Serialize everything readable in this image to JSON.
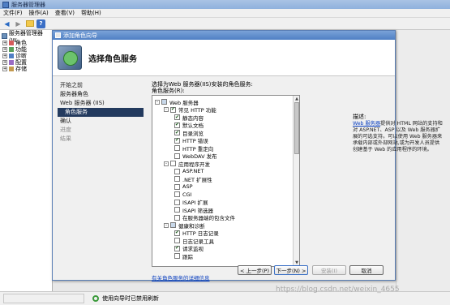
{
  "server_manager": {
    "title": "服务器管理器",
    "menu": [
      "文件(F)",
      "操作(A)",
      "查看(V)",
      "帮助(H)"
    ],
    "tree": {
      "root": "服务器管理器 (W",
      "items": [
        "角色",
        "功能",
        "诊断",
        "配置",
        "存储"
      ]
    },
    "status_text": "使用向导时已禁用刷新"
  },
  "wizard": {
    "title": "添加角色向导",
    "header_title": "选择角色服务",
    "nav": [
      {
        "label": "开始之前",
        "state": "normal"
      },
      {
        "label": "服务器角色",
        "state": "normal"
      },
      {
        "label": "Web 服务器 (IIS)",
        "state": "normal"
      },
      {
        "label": "角色服务",
        "state": "active"
      },
      {
        "label": "确认",
        "state": "normal"
      },
      {
        "label": "进度",
        "state": "disabled"
      },
      {
        "label": "结果",
        "state": "disabled"
      }
    ],
    "prompt": "选择为Web 服务器(IIS)安装的角色服务:",
    "services_label": "角色服务(R):",
    "services": [
      {
        "label": "Web 服务器",
        "level": 0,
        "check": "partial",
        "expander": "-"
      },
      {
        "label": "常见 HTTP 功能",
        "level": 1,
        "check": "checked",
        "expander": "-"
      },
      {
        "label": "静态内容",
        "level": 2,
        "check": "checked"
      },
      {
        "label": "默认文档",
        "level": 2,
        "check": "checked"
      },
      {
        "label": "目录浏览",
        "level": 2,
        "check": "checked"
      },
      {
        "label": "HTTP 错误",
        "level": 2,
        "check": "checked"
      },
      {
        "label": "HTTP 重定向",
        "level": 2,
        "check": "none"
      },
      {
        "label": "WebDAV 发布",
        "level": 2,
        "check": "none"
      },
      {
        "label": "应用程序开发",
        "level": 1,
        "check": "none",
        "expander": "-"
      },
      {
        "label": "ASP.NET",
        "level": 2,
        "check": "none"
      },
      {
        "label": ".NET 扩展性",
        "level": 2,
        "check": "none"
      },
      {
        "label": "ASP",
        "level": 2,
        "check": "none"
      },
      {
        "label": "CGI",
        "level": 2,
        "check": "none"
      },
      {
        "label": "ISAPI 扩展",
        "level": 2,
        "check": "none"
      },
      {
        "label": "ISAPI 筛选器",
        "level": 2,
        "check": "none"
      },
      {
        "label": "在服务器端的包含文件",
        "level": 2,
        "check": "none"
      },
      {
        "label": "健康和诊断",
        "level": 1,
        "check": "partial",
        "expander": "-"
      },
      {
        "label": "HTTP 日志记录",
        "level": 2,
        "check": "checked"
      },
      {
        "label": "日志记录工具",
        "level": 2,
        "check": "none"
      },
      {
        "label": "请求监视",
        "level": 2,
        "check": "checked"
      },
      {
        "label": "跟踪",
        "level": 2,
        "check": "none"
      }
    ],
    "description_title": "描述:",
    "description_link": "Web 服务器",
    "description_body": "提供对 HTML 网站的支持和对 ASP.NET、ASP 以及 Web 服务器扩展的可选支持。可以使用 Web 服务器来承载内部或外部网站,或为开发人员提供创建基于 Web 的应用程序的环境。",
    "more_info_link": "有关角色服务的详细信息",
    "buttons": {
      "prev": "< 上一步(P)",
      "next": "下一步(N) >",
      "install": "安装(I)",
      "cancel": "取消"
    }
  },
  "watermark": "https://blog.csdn.net/weixin_4655"
}
